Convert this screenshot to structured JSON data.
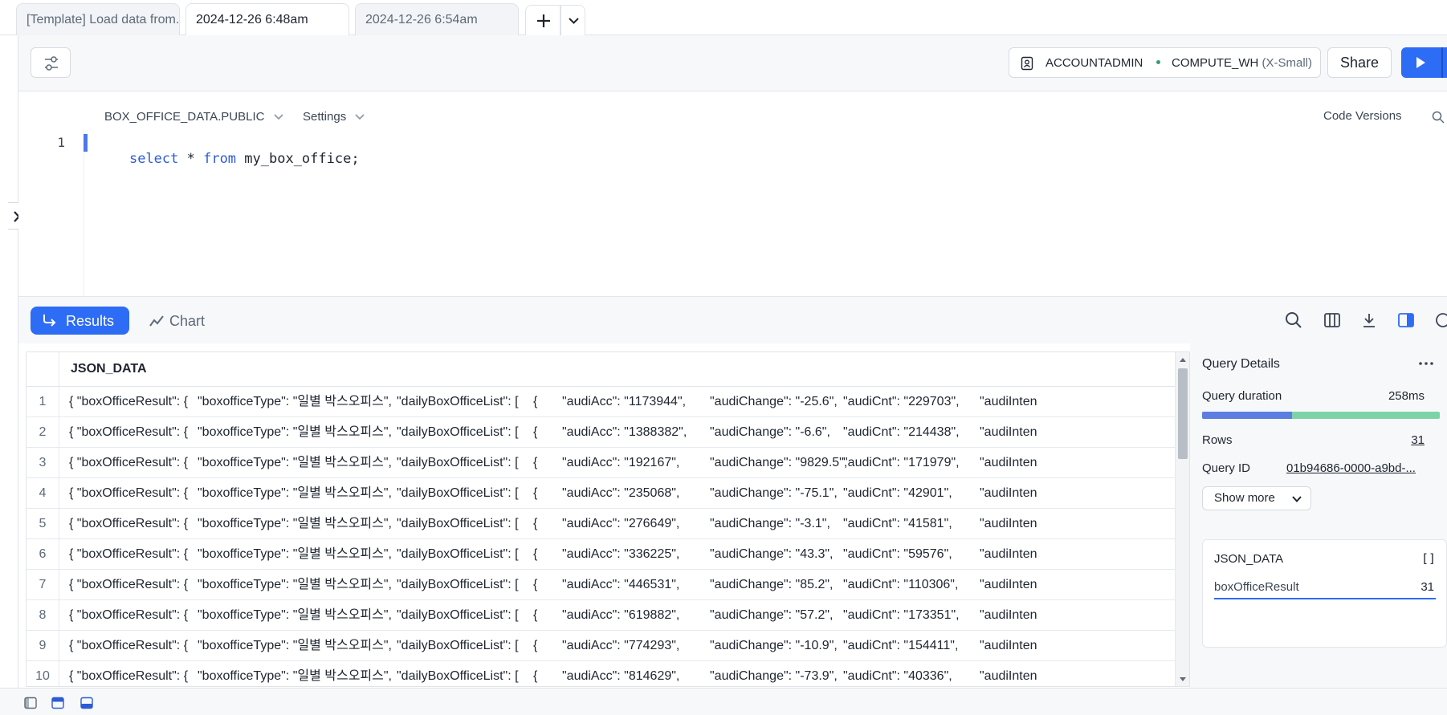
{
  "tabs": [
    {
      "label": "[Template] Load data from..."
    },
    {
      "label": "2024-12-26 6:48am"
    },
    {
      "label": "2024-12-26 6:54am"
    }
  ],
  "toolbar": {
    "role": "ACCOUNTADMIN",
    "warehouse": "COMPUTE_WH",
    "warehouse_size": "(X-Small)",
    "share_label": "Share"
  },
  "editor": {
    "database": "BOX_OFFICE_DATA.PUBLIC",
    "settings_label": "Settings",
    "code_versions_label": "Code Versions",
    "line_number": "1",
    "code": {
      "kw1": "select",
      "star": " * ",
      "kw2": "from",
      "rest": " my_box_office;"
    }
  },
  "results": {
    "results_label": "Results",
    "chart_label": "Chart",
    "column_header": "JSON_DATA",
    "rows": [
      {
        "n": "1",
        "a": "{  \"boxOfficeResult\": {",
        "b": "\"boxofficeType\": \"일별 박스오피스\",",
        "c": "\"dailyBoxOfficeList\": [",
        "d": "{",
        "e": "\"audiAcc\": \"1173944\",",
        "f": "\"audiChange\": \"-25.6\",",
        "g": "\"audiCnt\": \"229703\",",
        "h": "\"audiInten"
      },
      {
        "n": "2",
        "a": "{  \"boxOfficeResult\": {",
        "b": "\"boxofficeType\": \"일별 박스오피스\",",
        "c": "\"dailyBoxOfficeList\": [",
        "d": "{",
        "e": "\"audiAcc\": \"1388382\",",
        "f": "\"audiChange\": \"-6.6\",",
        "g": "\"audiCnt\": \"214438\",",
        "h": "\"audiInten"
      },
      {
        "n": "3",
        "a": "{  \"boxOfficeResult\": {",
        "b": "\"boxofficeType\": \"일별 박스오피스\",",
        "c": "\"dailyBoxOfficeList\": [",
        "d": "{",
        "e": "\"audiAcc\": \"192167\",",
        "f": "\"audiChange\": \"9829.5\",",
        "g": "\"audiCnt\": \"171979\",",
        "h": "\"audiInten"
      },
      {
        "n": "4",
        "a": "{  \"boxOfficeResult\": {",
        "b": "\"boxofficeType\": \"일별 박스오피스\",",
        "c": "\"dailyBoxOfficeList\": [",
        "d": "{",
        "e": "\"audiAcc\": \"235068\",",
        "f": "\"audiChange\": \"-75.1\",",
        "g": "\"audiCnt\": \"42901\",",
        "h": "\"audiInten"
      },
      {
        "n": "5",
        "a": "{  \"boxOfficeResult\": {",
        "b": "\"boxofficeType\": \"일별 박스오피스\",",
        "c": "\"dailyBoxOfficeList\": [",
        "d": "{",
        "e": "\"audiAcc\": \"276649\",",
        "f": "\"audiChange\": \"-3.1\",",
        "g": "\"audiCnt\": \"41581\",",
        "h": "\"audiInten"
      },
      {
        "n": "6",
        "a": "{  \"boxOfficeResult\": {",
        "b": "\"boxofficeType\": \"일별 박스오피스\",",
        "c": "\"dailyBoxOfficeList\": [",
        "d": "{",
        "e": "\"audiAcc\": \"336225\",",
        "f": "\"audiChange\": \"43.3\",",
        "g": "\"audiCnt\": \"59576\",",
        "h": "\"audiInten"
      },
      {
        "n": "7",
        "a": "{  \"boxOfficeResult\": {",
        "b": "\"boxofficeType\": \"일별 박스오피스\",",
        "c": "\"dailyBoxOfficeList\": [",
        "d": "{",
        "e": "\"audiAcc\": \"446531\",",
        "f": "\"audiChange\": \"85.2\",",
        "g": "\"audiCnt\": \"110306\",",
        "h": "\"audiInten"
      },
      {
        "n": "8",
        "a": "{  \"boxOfficeResult\": {",
        "b": "\"boxofficeType\": \"일별 박스오피스\",",
        "c": "\"dailyBoxOfficeList\": [",
        "d": "{",
        "e": "\"audiAcc\": \"619882\",",
        "f": "\"audiChange\": \"57.2\",",
        "g": "\"audiCnt\": \"173351\",",
        "h": "\"audiInten"
      },
      {
        "n": "9",
        "a": "{  \"boxOfficeResult\": {",
        "b": "\"boxofficeType\": \"일별 박스오피스\",",
        "c": "\"dailyBoxOfficeList\": [",
        "d": "{",
        "e": "\"audiAcc\": \"774293\",",
        "f": "\"audiChange\": \"-10.9\",",
        "g": "\"audiCnt\": \"154411\",",
        "h": "\"audiInten"
      },
      {
        "n": "10",
        "a": "{  \"boxOfficeResult\": {",
        "b": "\"boxofficeType\": \"일별 박스오피스\",",
        "c": "\"dailyBoxOfficeList\": [",
        "d": "{",
        "e": "\"audiAcc\": \"814629\",",
        "f": "\"audiChange\": \"-73.9\",",
        "g": "\"audiCnt\": \"40336\",",
        "h": "\"audiInten"
      }
    ]
  },
  "details": {
    "title": "Query Details",
    "duration_label": "Query duration",
    "duration_value": "258ms",
    "duration_split": 0.38,
    "rows_label": "Rows",
    "rows_value": "31",
    "query_id_label": "Query ID",
    "query_id_value": "01b94686-0000-a9bd-...",
    "show_more_label": "Show more",
    "column_card": {
      "name": "JSON_DATA",
      "type_icon": "[]",
      "field": "boxOfficeResult",
      "count": "31"
    }
  },
  "colors": {
    "accent": "#2d6cf5",
    "duration_bar_a": "#5b7ee0",
    "duration_bar_b": "#7dd3a8"
  }
}
